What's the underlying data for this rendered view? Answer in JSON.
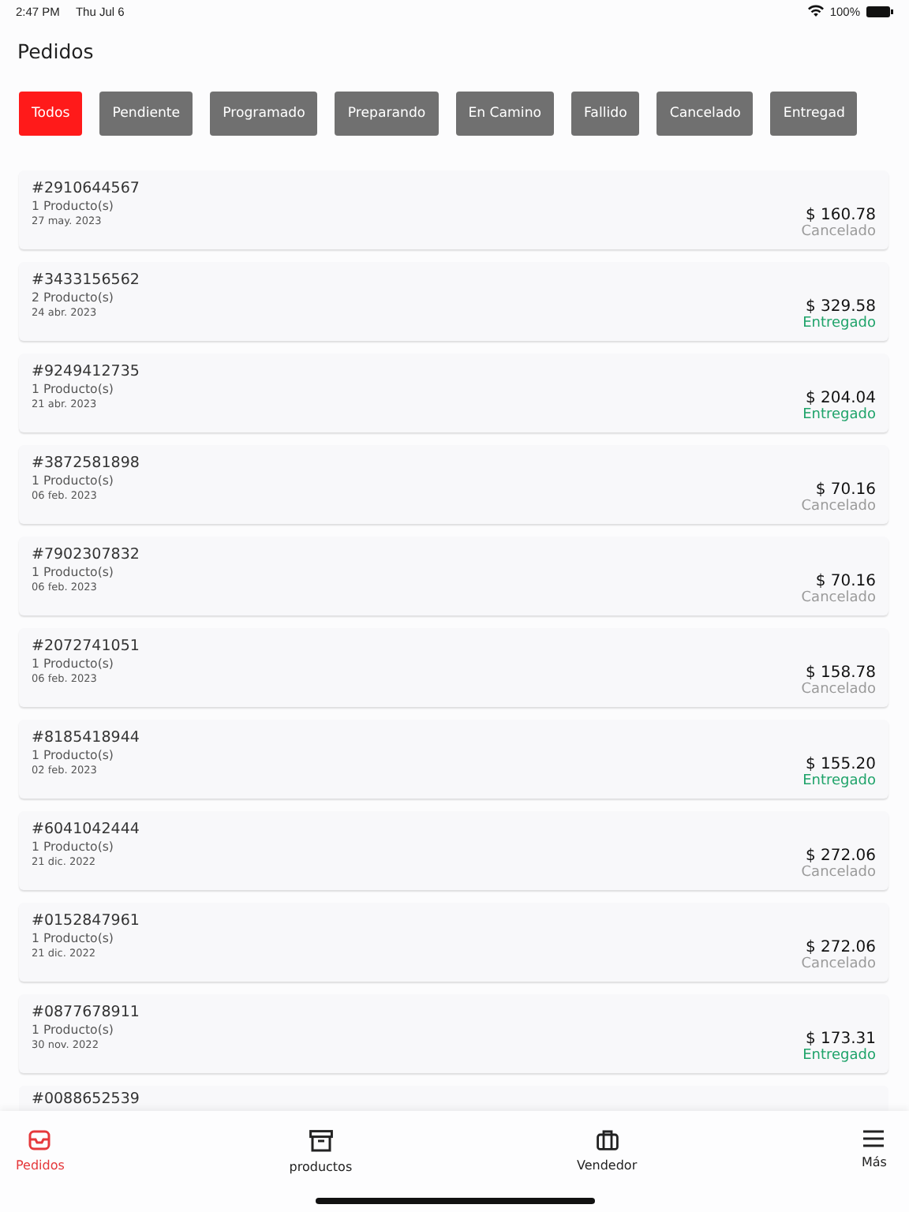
{
  "status_bar": {
    "time": "2:47 PM",
    "date": "Thu Jul 6",
    "battery": "100%"
  },
  "title": "Pedidos",
  "filters": [
    {
      "label": "Todos",
      "selected": true
    },
    {
      "label": "Pendiente",
      "selected": false
    },
    {
      "label": "Programado",
      "selected": false
    },
    {
      "label": "Preparando",
      "selected": false
    },
    {
      "label": "En Camino",
      "selected": false
    },
    {
      "label": "Fallido",
      "selected": false
    },
    {
      "label": "Cancelado",
      "selected": false
    },
    {
      "label": "Entregad",
      "selected": false
    }
  ],
  "orders": [
    {
      "number": "#2910644567",
      "products": "1 Producto(s)",
      "date": "27 may. 2023",
      "total": "$ 160.78",
      "status": "Cancelado",
      "kind": "cancelled"
    },
    {
      "number": "#3433156562",
      "products": "2 Producto(s)",
      "date": "24 abr. 2023",
      "total": "$ 329.58",
      "status": "Entregado",
      "kind": "delivered"
    },
    {
      "number": "#9249412735",
      "products": "1 Producto(s)",
      "date": "21 abr. 2023",
      "total": "$ 204.04",
      "status": "Entregado",
      "kind": "delivered"
    },
    {
      "number": "#3872581898",
      "products": "1 Producto(s)",
      "date": "06 feb. 2023",
      "total": "$ 70.16",
      "status": "Cancelado",
      "kind": "cancelled"
    },
    {
      "number": "#7902307832",
      "products": "1 Producto(s)",
      "date": "06 feb. 2023",
      "total": "$ 70.16",
      "status": "Cancelado",
      "kind": "cancelled"
    },
    {
      "number": "#2072741051",
      "products": "1 Producto(s)",
      "date": "06 feb. 2023",
      "total": "$ 158.78",
      "status": "Cancelado",
      "kind": "cancelled"
    },
    {
      "number": "#8185418944",
      "products": "1 Producto(s)",
      "date": "02 feb. 2023",
      "total": "$ 155.20",
      "status": "Entregado",
      "kind": "delivered"
    },
    {
      "number": "#6041042444",
      "products": "1 Producto(s)",
      "date": "21 dic. 2022",
      "total": "$ 272.06",
      "status": "Cancelado",
      "kind": "cancelled"
    },
    {
      "number": "#0152847961",
      "products": "1 Producto(s)",
      "date": "21 dic. 2022",
      "total": "$ 272.06",
      "status": "Cancelado",
      "kind": "cancelled"
    },
    {
      "number": "#0877678911",
      "products": "1 Producto(s)",
      "date": "30 nov. 2022",
      "total": "$ 173.31",
      "status": "Entregado",
      "kind": "delivered"
    },
    {
      "number": "#0088652539",
      "kind": "partial"
    }
  ],
  "tab_bar": [
    {
      "label": "Pedidos",
      "selected": true
    },
    {
      "label": "productos",
      "selected": false
    },
    {
      "label": "Vendedor",
      "selected": false
    },
    {
      "label": "Más",
      "selected": false
    }
  ]
}
